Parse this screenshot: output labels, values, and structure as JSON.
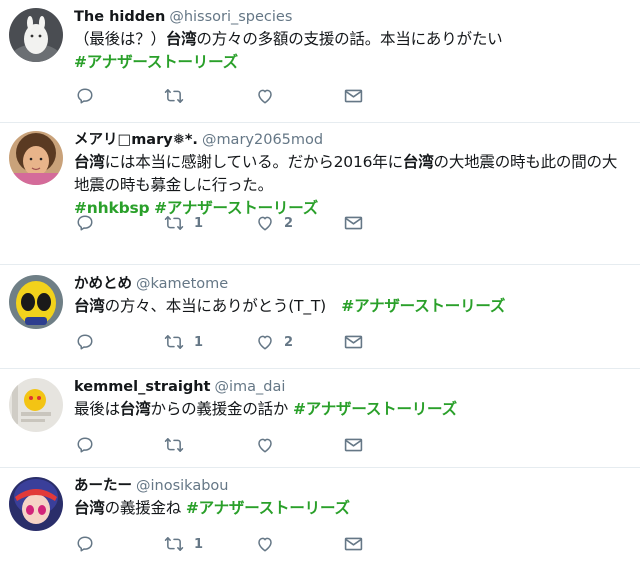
{
  "tweets": [
    {
      "name": "The hidden",
      "handle": "@hissori_species",
      "lines": [
        [
          {
            "t": "（最後は？）"
          },
          {
            "t": "台湾",
            "b": true
          },
          {
            "t": "の方々の多額の支援の話。本当にありがたい"
          }
        ],
        [
          {
            "t": "#アナザーストーリーズ",
            "tag": true
          }
        ]
      ],
      "reply_count": "",
      "retweet_count": "",
      "like_count": ""
    },
    {
      "name": "メアリ□mary❅*.",
      "handle": "@mary2065mod",
      "lines": [
        [
          {
            "t": "台湾",
            "b": true
          },
          {
            "t": "には本当に感謝している。だから2016年に"
          },
          {
            "t": "台湾",
            "b": true
          },
          {
            "t": "の大地震の時も此の間の大"
          }
        ],
        [
          {
            "t": "地震の時も募金しに行った。"
          }
        ],
        [
          {
            "t": "#nhkbsp",
            "tag": true
          },
          {
            "t": " "
          },
          {
            "t": "#アナザーストーリーズ",
            "tag": true
          }
        ]
      ],
      "reply_count": "",
      "retweet_count": "1",
      "like_count": "2"
    },
    {
      "name": "かめとめ",
      "handle": "@kametome",
      "lines": [
        [
          {
            "t": "台湾",
            "b": true
          },
          {
            "t": "の方々、本当にありがとう(T_T)　"
          },
          {
            "t": "#アナザーストーリーズ",
            "tag": true
          }
        ]
      ],
      "reply_count": "",
      "retweet_count": "1",
      "like_count": "2"
    },
    {
      "name": "kemmel_straight",
      "handle": "@ima_dai",
      "lines": [
        [
          {
            "t": "最後は"
          },
          {
            "t": "台湾",
            "b": true
          },
          {
            "t": "からの義援金の話か "
          },
          {
            "t": "#アナザーストーリーズ",
            "tag": true
          }
        ]
      ],
      "reply_count": "",
      "retweet_count": "",
      "like_count": ""
    },
    {
      "name": "あーたー",
      "handle": "@inosikabou",
      "lines": [
        [
          {
            "t": "台湾",
            "b": true
          },
          {
            "t": "の義援金ね "
          },
          {
            "t": "#アナザーストーリーズ",
            "tag": true
          }
        ]
      ],
      "reply_count": "",
      "retweet_count": "1",
      "like_count": ""
    }
  ],
  "icons": {
    "reply": "reply-icon",
    "retweet": "retweet-icon",
    "like": "heart-icon",
    "dm": "envelope-icon"
  },
  "colors": {
    "hashtag": "#2aa02a",
    "name": "#14171a",
    "handle": "#657786",
    "action": "#657786",
    "divider": "#e6ecf0"
  }
}
